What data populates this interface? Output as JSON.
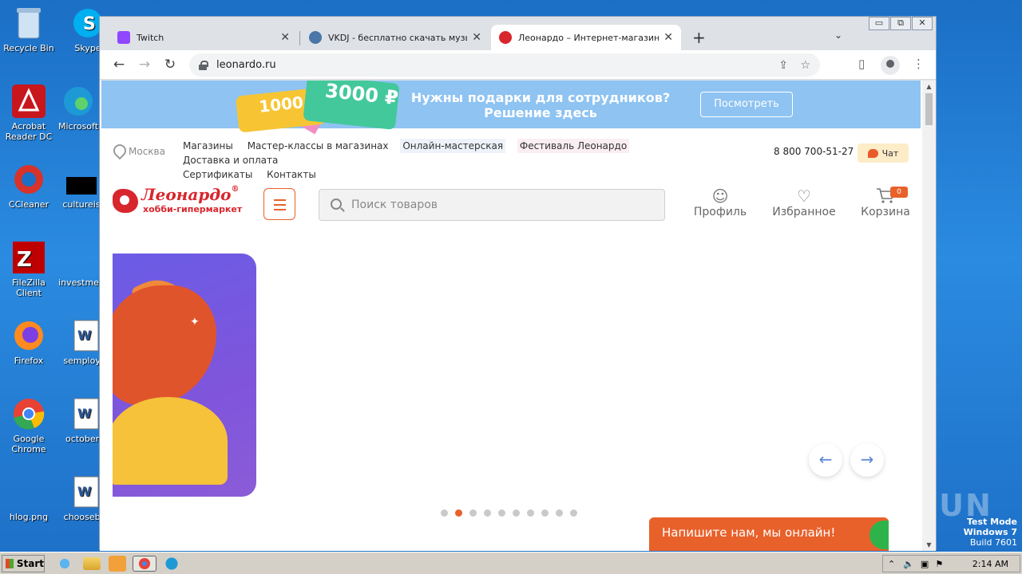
{
  "desktop": {
    "icons": [
      {
        "label": "Recycle Bin",
        "icon": "recycle-bin-icon"
      },
      {
        "label": "Skype",
        "icon": "skype-icon"
      },
      {
        "label": "Acrobat Reader DC",
        "icon": "acrobat-icon"
      },
      {
        "label": "Microsoft",
        "icon": "edge-icon"
      },
      {
        "label": "CCleaner",
        "icon": "ccleaner-icon"
      },
      {
        "label": "cultureis",
        "icon": "file-icon"
      },
      {
        "label": "FileZilla Client",
        "icon": "filezilla-icon"
      },
      {
        "label": "investmen",
        "icon": "file-icon"
      },
      {
        "label": "Firefox",
        "icon": "firefox-icon"
      },
      {
        "label": "semploye",
        "icon": "word-doc-icon"
      },
      {
        "label": "Google Chrome",
        "icon": "chrome-icon"
      },
      {
        "label": "octoberc",
        "icon": "word-doc-icon"
      },
      {
        "label": "hlog.png",
        "icon": "image-file-icon"
      },
      {
        "label": "chooseba",
        "icon": "word-doc-icon"
      }
    ]
  },
  "browser": {
    "tabs": [
      {
        "title": "Twitch",
        "favicon_color": "#9146ff"
      },
      {
        "title": "VKDJ - бесплатно скачать музыку",
        "favicon_color": "#4a76a8"
      },
      {
        "title": "Леонардо – Интернет-магазин для",
        "favicon_color": "#d8262d"
      }
    ],
    "new_tab_symbol": "+",
    "tab_menu_symbol": "⌄",
    "window_buttons": [
      "▭",
      "⧉",
      "✕"
    ],
    "url": "leonardo.ru",
    "nav": {
      "back": "←",
      "forward": "→",
      "reload": "↻"
    },
    "toolbar_icons": {
      "share": "⇪",
      "star": "☆",
      "side_panel": "▯",
      "menu": "⋮"
    }
  },
  "page": {
    "promo": {
      "card1": "1000",
      "card2": "3000 ₽",
      "line1": "Нужны подарки для сотрудников?",
      "line2": "Решение здесь",
      "button": "Посмотреть"
    },
    "city": "Москва",
    "nav_links": [
      "Магазины",
      "Мастер-классы в магазинах",
      "Онлайн-мастерская",
      "Фестиваль Леонардо",
      "Доставка и оплата",
      "Сертификаты",
      "Контакты"
    ],
    "phone": "8 800 700-51-27",
    "chat": "Чат",
    "logo": {
      "name": "Леонардо",
      "registered": "®",
      "tagline": "хобби-гипермаркет"
    },
    "search_placeholder": "Поиск товаров",
    "header_icons": [
      {
        "label": "Профиль",
        "glyph": "☺"
      },
      {
        "label": "Избранное",
        "glyph": "♡"
      },
      {
        "label": "Корзина",
        "glyph": "🛒",
        "badge": "0"
      }
    ],
    "slider": {
      "prev": "←",
      "next": "→",
      "dots": 10,
      "active_dot": 2
    },
    "chat_widget": "Напишите нам, мы онлайн!"
  },
  "taskbar": {
    "start_label": "Start",
    "time": "2:14 AM",
    "tray_icons": [
      "chevron-up-icon",
      "speaker-icon",
      "network-icon",
      "flag-icon"
    ]
  },
  "watermark": "ANY.RUN",
  "testmode": {
    "line1": "Test Mode",
    "line2": "Windows 7",
    "line3": "Build 7601"
  }
}
